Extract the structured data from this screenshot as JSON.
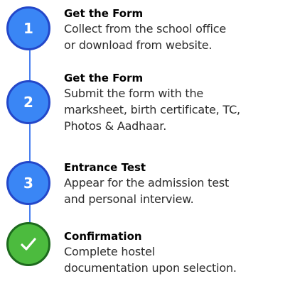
{
  "steps": [
    {
      "marker": "1",
      "title": "Get the Form",
      "description_lines": [
        "Collect from the school office",
        "or download from website."
      ]
    },
    {
      "marker": "2",
      "title": "Get the Form",
      "description_lines": [
        "Submit the form with the",
        "marksheet, birth certificate, TC,",
        "Photos & Aadhaar."
      ]
    },
    {
      "marker": "3",
      "title": "Entrance Test",
      "description_lines": [
        "Appear for the admission test",
        "and personal interview."
      ]
    },
    {
      "marker": "check-icon",
      "title": "Confirmation",
      "description_lines": [
        "Complete hostel",
        "documentation upon selection."
      ]
    }
  ],
  "colors": {
    "step_fill": "#3a86f5",
    "step_border": "#2347c9",
    "done_fill": "#4cbb3e",
    "done_border": "#1d6a1d",
    "connector": "#4a80f0"
  }
}
